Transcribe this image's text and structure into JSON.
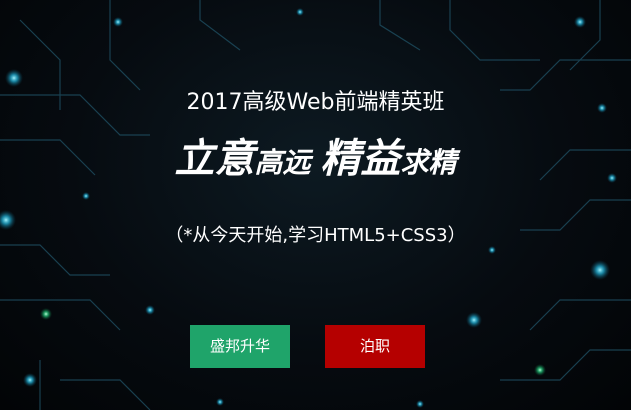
{
  "banner": {
    "subtitle": "2017高级Web前端精英班",
    "headline": {
      "part1": "立意",
      "part2": "高远",
      "part3": "精益",
      "part4": "求精"
    },
    "tagline": "（*从今天开始,学习HTML5+CSS3）"
  },
  "buttons": {
    "primary_label": "盛邦升华",
    "secondary_label": "泊职"
  },
  "colors": {
    "primary_button": "#1fa46a",
    "secondary_button": "#b50000",
    "circuit_glow": "#2aa6c8",
    "background": "#05090d"
  }
}
